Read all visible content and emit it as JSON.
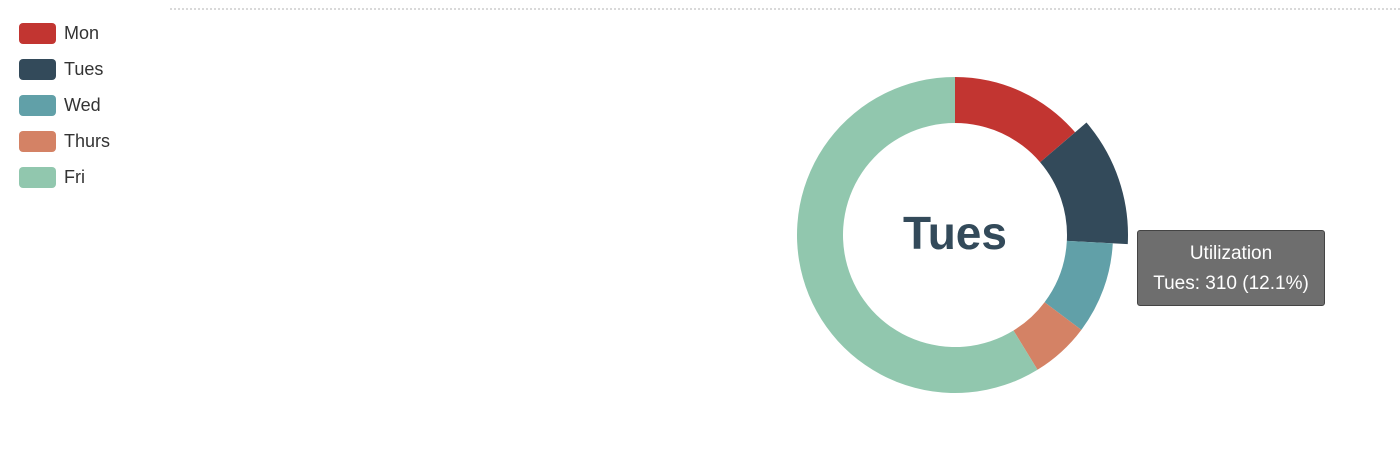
{
  "chart_data": {
    "type": "pie",
    "variant": "donut",
    "categories": [
      "Mon",
      "Tues",
      "Wed",
      "Thurs",
      "Fri"
    ],
    "values": [
      352,
      310,
      241,
      154,
      1505
    ],
    "colors": [
      "#c23531",
      "#334a5a",
      "#61a0a8",
      "#d48265",
      "#91c7ae"
    ],
    "legend_position": "top-left",
    "highlighted": "Tues",
    "center_label": "Tues"
  },
  "tooltip": {
    "title": "Utilization",
    "text": "Tues: 310 (12.1%)"
  }
}
